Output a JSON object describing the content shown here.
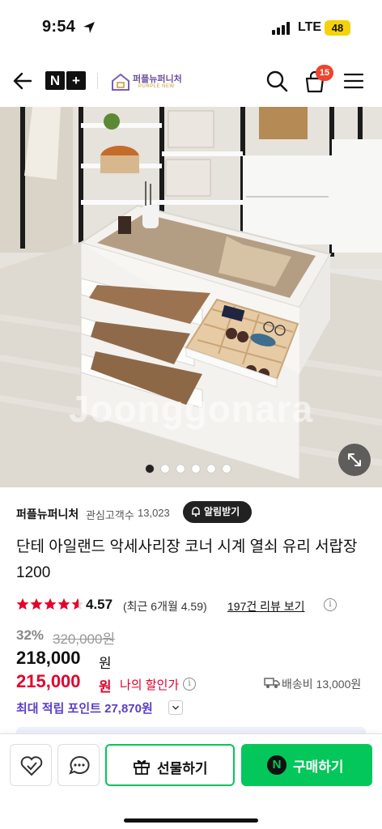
{
  "status_bar": {
    "time": "9:54",
    "network": "LTE",
    "battery": "48"
  },
  "header": {
    "nplus_left": "N",
    "nplus_right": "+",
    "brand_name": "퍼플뉴퍼니처",
    "brand_sub": "PURPLE NEW",
    "cart_count": "15"
  },
  "hero": {
    "watermark": "Joonggonara",
    "slide_count": 6,
    "active_slide": 1
  },
  "store": {
    "name": "퍼플뉴퍼니처",
    "fans_label": "관심고객수",
    "fans_count": "13,023",
    "notify_label": "알림받기"
  },
  "product": {
    "title": "단테 아일랜드 악세사리장 코너 시계 열쇠 유리 서랍장 1200",
    "rating": "4.57",
    "rating_stars": 4.57,
    "rating_recent": "(최근 6개월 4.59)",
    "review_link": "197건 리뷰 보기",
    "discount": "32%",
    "original_price": "320,000원",
    "sale_price": "218,000",
    "sale_unit": "원",
    "my_price": "215,000",
    "my_unit": "원",
    "my_price_label": "나의 할인가",
    "shipping": "배송비 13,000원",
    "points": "최대 적립 포인트 27,870원"
  },
  "bottom_bar": {
    "gift_label": "선물하기",
    "buy_icon": "N",
    "buy_label": "구매하기"
  },
  "colors": {
    "accent_green": "#03c75a",
    "price_red": "#e4002b",
    "points_purple": "#5a3dc8",
    "badge_red": "#f0432c"
  }
}
